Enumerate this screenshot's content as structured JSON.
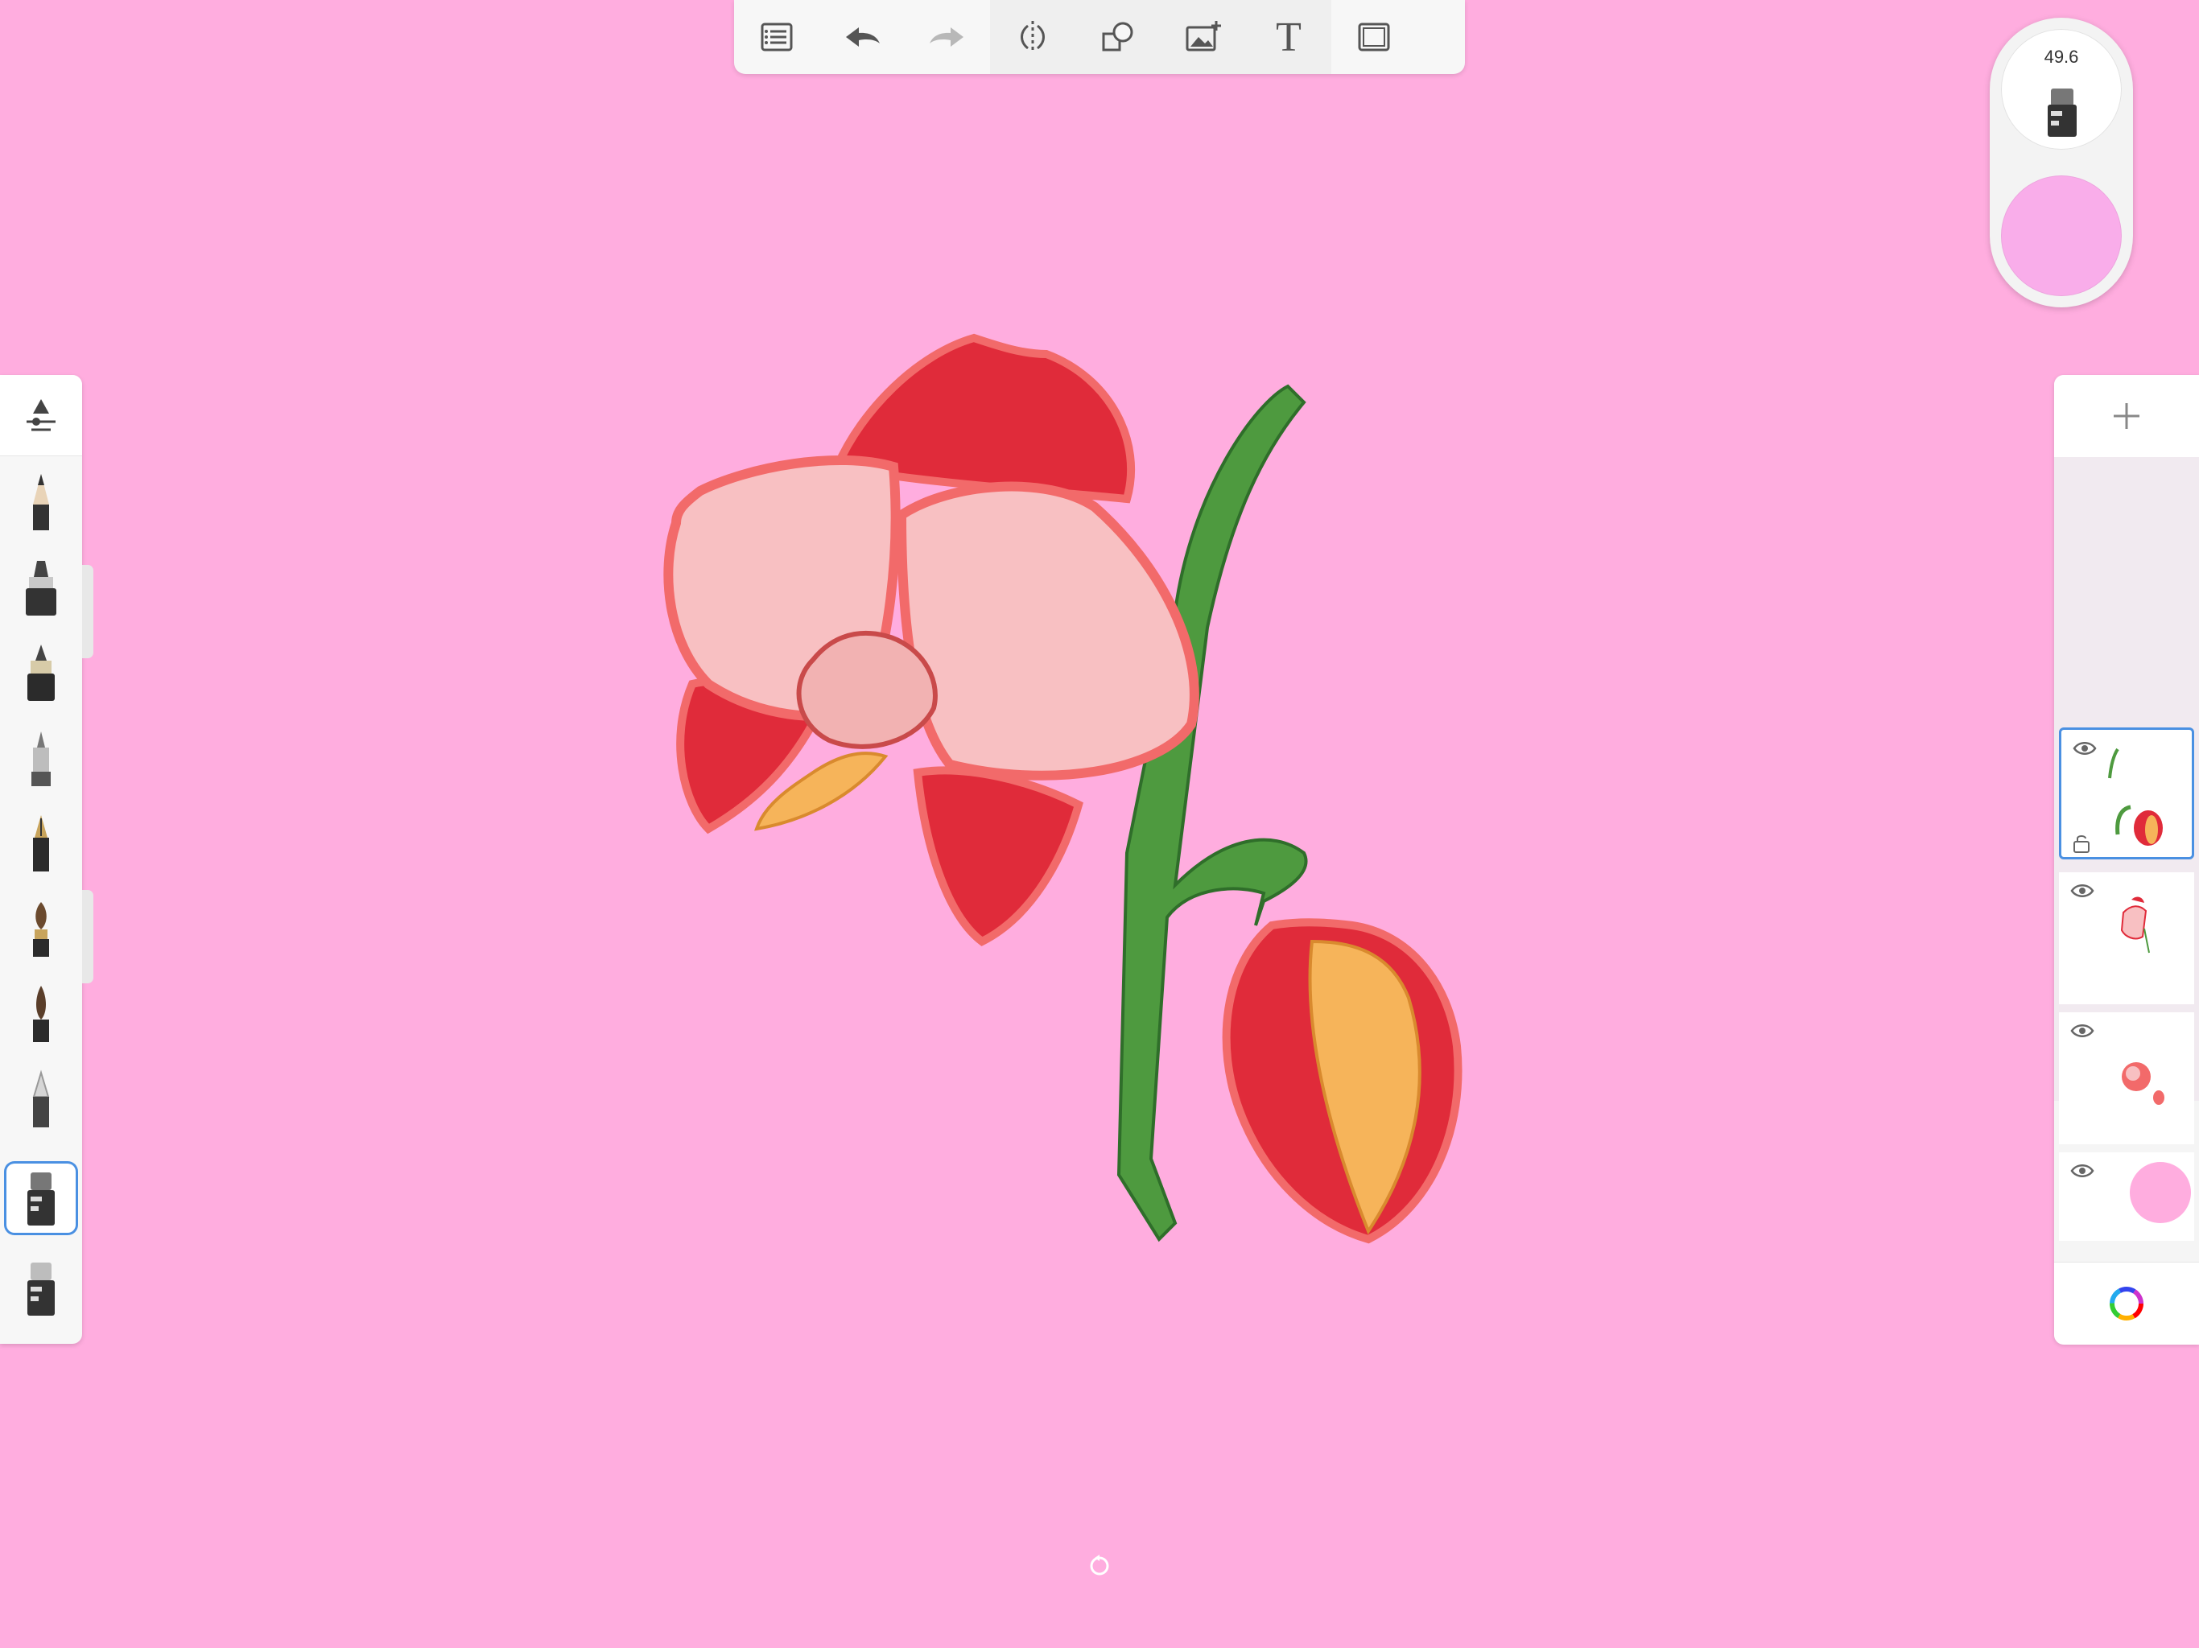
{
  "toolbar": {
    "items": [
      {
        "id": "gallery",
        "icon": "list-icon"
      },
      {
        "id": "undo",
        "icon": "undo-icon"
      },
      {
        "id": "redo",
        "icon": "redo-icon",
        "disabled": true
      },
      {
        "id": "symmetry",
        "icon": "symmetry-icon"
      },
      {
        "id": "shapes",
        "icon": "shapes-icon"
      },
      {
        "id": "image",
        "icon": "add-image-icon"
      },
      {
        "id": "text",
        "icon": "text-icon",
        "label": "T"
      },
      {
        "id": "fullscreen",
        "icon": "fullscreen-icon"
      }
    ]
  },
  "brush_puck": {
    "size_label": "49.6",
    "current_color": "#F9ADEA"
  },
  "brush_panel": {
    "tools": [
      "brush-properties-icon",
      "pencil-icon",
      "marker-icon",
      "ink-pen-icon",
      "airbrush-icon",
      "fountain-pen-icon",
      "paint-brush-icon",
      "soft-brush-icon",
      "smudge-icon",
      "eraser-icon",
      "fill-eraser-icon"
    ],
    "selected": "eraser-icon"
  },
  "layers_panel": {
    "layers": [
      {
        "name": "layer-bud-stem",
        "visible": true,
        "selected": true
      },
      {
        "name": "layer-flower-linework",
        "visible": true
      },
      {
        "name": "layer-flower-color",
        "visible": true
      },
      {
        "name": "layer-background",
        "visible": true,
        "color": "#FFADDF"
      }
    ]
  },
  "colors": {
    "canvas": "#FFADDF",
    "accent": "#4A90E2",
    "petal": "#F26A6A",
    "petal_dark": "#E02B3A",
    "stem": "#4E9A3F",
    "bud_inner": "#F6B45A"
  }
}
